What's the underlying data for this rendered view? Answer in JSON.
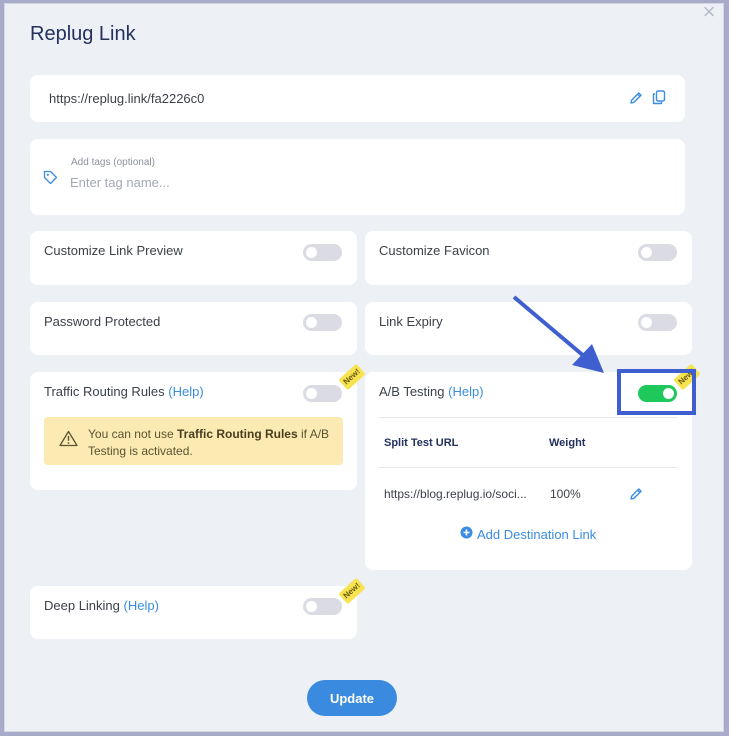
{
  "modal": {
    "title": "Replug Link",
    "close_glyph": "×",
    "link_url": "https://replug.link/fa2226c0",
    "tags": {
      "label": "Add tags (optional)",
      "placeholder": "Enter tag name..."
    },
    "options": {
      "customize_link_preview": {
        "label": "Customize Link Preview",
        "enabled": false
      },
      "customize_favicon": {
        "label": "Customize Favicon",
        "enabled": false
      },
      "password_protected": {
        "label": "Password Protected",
        "enabled": false
      },
      "link_expiry": {
        "label": "Link Expiry",
        "enabled": false
      },
      "traffic_routing": {
        "label": "Traffic Routing Rules",
        "help": "(Help)",
        "badge": "New!",
        "enabled": false,
        "warning": {
          "prefix": "You can not use",
          "bold": "Traffic Routing Rules",
          "suffix": "if A/B Testing is activated."
        }
      },
      "ab_testing": {
        "label": "A/B Testing",
        "help": "(Help)",
        "badge": "New!",
        "enabled": true,
        "table": {
          "headers": [
            "Split Test URL",
            "Weight"
          ],
          "rows": [
            {
              "url": "https://blog.replug.io/soci...",
              "weight": "100%"
            }
          ]
        },
        "add_destination": "Add Destination Link"
      },
      "deep_linking": {
        "label": "Deep Linking",
        "help": "(Help)",
        "badge": "New!",
        "enabled": false
      }
    },
    "update_label": "Update"
  },
  "colors": {
    "accent": "#3a8be0",
    "toggle_on": "#1ec85b",
    "toggle_off": "#dadbe3",
    "badge": "#f7e24f",
    "warning_bg": "#fbeab1",
    "annotation": "#3f5ed0"
  }
}
